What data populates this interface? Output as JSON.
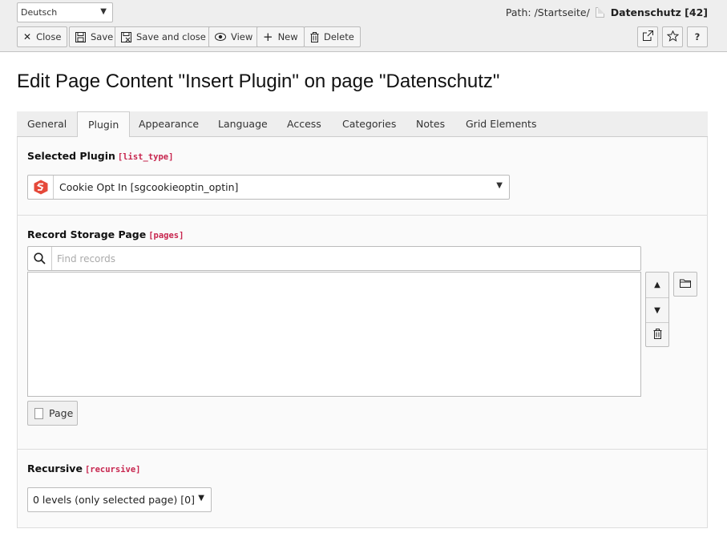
{
  "header": {
    "language": "Deutsch",
    "path_prefix": "Path: /Startseite/",
    "page_title": "Datenschutz [42]",
    "buttons": {
      "close": "Close",
      "save": "Save",
      "save_close": "Save and close",
      "view": "View",
      "new": "New",
      "delete": "Delete",
      "help": "?"
    }
  },
  "title": "Edit Page Content \"Insert Plugin\" on page \"Datenschutz\"",
  "tabs": [
    "General",
    "Plugin",
    "Appearance",
    "Language",
    "Access",
    "Categories",
    "Notes",
    "Grid Elements"
  ],
  "active_tab": "Plugin",
  "fields": {
    "plugin": {
      "label": "Selected Plugin",
      "key": "[list_type]",
      "value": "Cookie Opt In [sgcookieoptin_optin]"
    },
    "storage": {
      "label": "Record Storage Page",
      "key": "[pages]",
      "placeholder": "Find records",
      "page_button": "Page"
    },
    "recursive": {
      "label": "Recursive",
      "key": "[recursive]",
      "value": "0 levels (only selected page) [0]"
    }
  },
  "colors": {
    "accent_red": "#c7254e",
    "plugin_logo": "#e5493a"
  }
}
